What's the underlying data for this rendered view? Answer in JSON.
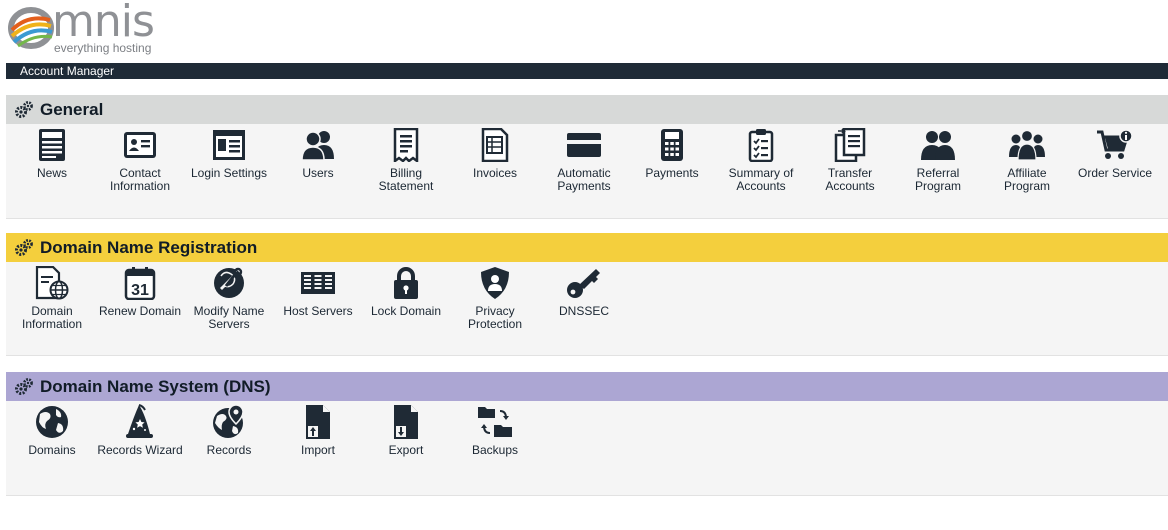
{
  "brand": {
    "name": "mnis",
    "tagline": "everything hosting",
    "accent": "#1f2b37"
  },
  "topbar": {
    "title": "Account Manager"
  },
  "sections": [
    {
      "title": "General",
      "color": "#d7d9d8",
      "items": [
        {
          "label": "News",
          "icon": "newspaper-icon"
        },
        {
          "label": "Contact Information",
          "icon": "contact-card-icon"
        },
        {
          "label": "Login Settings",
          "icon": "login-settings-icon"
        },
        {
          "label": "Users",
          "icon": "users-icon"
        },
        {
          "label": "Billing Statement",
          "icon": "receipt-icon"
        },
        {
          "label": "Invoices",
          "icon": "invoice-icon"
        },
        {
          "label": "Automatic Payments",
          "icon": "credit-card-icon"
        },
        {
          "label": "Payments",
          "icon": "calculator-icon"
        },
        {
          "label": "Summary of Accounts",
          "icon": "clipboard-checklist-icon"
        },
        {
          "label": "Transfer Accounts",
          "icon": "transfer-accounts-icon"
        },
        {
          "label": "Referral Program",
          "icon": "referral-icon"
        },
        {
          "label": "Affiliate Program",
          "icon": "group-icon"
        },
        {
          "label": "Order Service",
          "icon": "shopping-cart-icon"
        }
      ]
    },
    {
      "title": "Domain Name Registration",
      "color": "#f4cf3d",
      "items": [
        {
          "label": "Domain Information",
          "icon": "domain-info-icon"
        },
        {
          "label": "Renew Domain",
          "icon": "calendar-icon"
        },
        {
          "label": "Modify Name Servers",
          "icon": "wrench-globe-icon"
        },
        {
          "label": "Host Servers",
          "icon": "server-rack-icon"
        },
        {
          "label": "Lock Domain",
          "icon": "lock-icon"
        },
        {
          "label": "Privacy Protection",
          "icon": "shield-user-icon"
        },
        {
          "label": "DNSSEC",
          "icon": "key-icon"
        }
      ]
    },
    {
      "title": "Domain Name System (DNS)",
      "color": "#aca6d3",
      "items": [
        {
          "label": "Domains",
          "icon": "globe-icon"
        },
        {
          "label": "Records Wizard",
          "icon": "wizard-hat-icon"
        },
        {
          "label": "Records",
          "icon": "globe-pin-icon"
        },
        {
          "label": "Import",
          "icon": "import-icon"
        },
        {
          "label": "Export",
          "icon": "export-icon"
        },
        {
          "label": "Backups",
          "icon": "folder-sync-icon"
        }
      ]
    }
  ]
}
